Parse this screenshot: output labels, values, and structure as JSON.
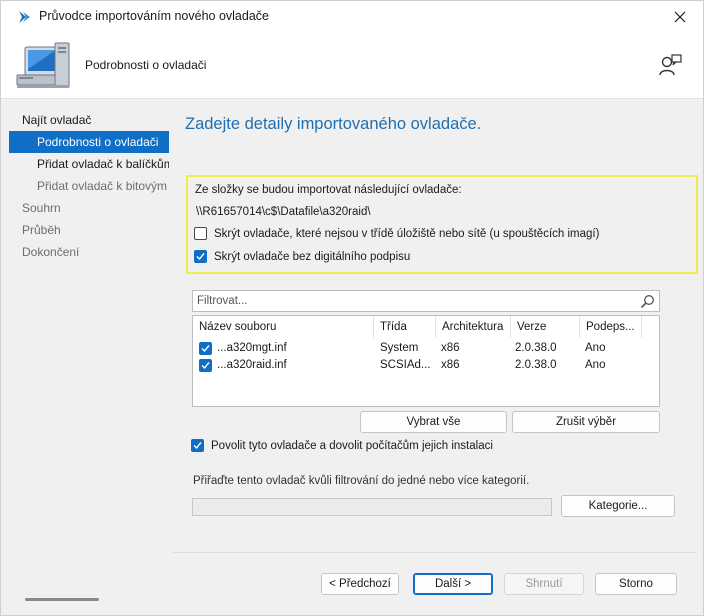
{
  "window": {
    "title": "Průvodce importováním nového ovladače"
  },
  "header": {
    "page_name": "Podrobnosti o ovladači"
  },
  "nav": {
    "items": [
      {
        "label": "Najít ovladač"
      },
      {
        "label": "Podrobnosti o ovladači"
      },
      {
        "label": "Přidat ovladač k balíčkům"
      },
      {
        "label": "Přidat ovladač k bitovým"
      },
      {
        "label": "Souhrn"
      },
      {
        "label": "Průběh"
      },
      {
        "label": "Dokončení"
      }
    ]
  },
  "content": {
    "title": "Zadejte detaily importovaného ovladače.",
    "import_label": "Ze složky se budou importovat následující ovladače:",
    "import_path": "\\\\R61657014\\c$\\Datafile\\a320raid\\",
    "hide_not_in_class": {
      "label": "Skrýt ovladače, které nejsou v třídě úložiště nebo sítě (u spouštěcích imagí)",
      "checked": false
    },
    "hide_unsigned": {
      "label": "Skrýt ovladače bez digitálního podpisu",
      "checked": true
    },
    "filter_placeholder": "Filtrovat...",
    "table": {
      "columns": [
        "Název souboru",
        "Třída",
        "Architektura",
        "Verze",
        "Podeps..."
      ],
      "rows": [
        {
          "checked": true,
          "file": "...a320mgt.inf",
          "class": "System",
          "arch": "x86",
          "version": "2.0.38.0",
          "signed": "Ano"
        },
        {
          "checked": true,
          "file": "...a320raid.inf",
          "class": "SCSIAd...",
          "arch": "x86",
          "version": "2.0.38.0",
          "signed": "Ano"
        }
      ]
    },
    "select_all": "Vybrat vše",
    "clear_selection": "Zrušit výběr",
    "enable_drivers": {
      "label": "Povolit tyto ovladače a dovolit počítačům jejich instalaci",
      "checked": true
    },
    "category_label": "Přiřaďte tento ovladač kvůli filtrování do jedné nebo více kategorií.",
    "category_value": "",
    "category_button": "Kategorie..."
  },
  "footer": {
    "previous": "< Předchozí",
    "next": "Další >",
    "summary": "Shrnutí",
    "cancel": "Storno"
  },
  "colors": {
    "accent": "#0f6fc6",
    "title_blue": "#1f6fb0",
    "highlight_border": "#f1ec4a"
  }
}
